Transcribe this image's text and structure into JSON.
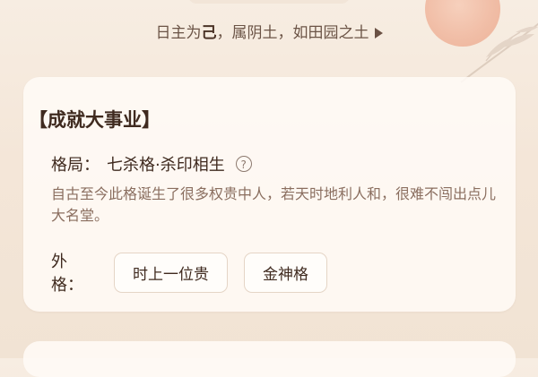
{
  "header": {
    "subtitle_prefix": "日主为",
    "subtitle_element": "己",
    "subtitle_suffix": "，属阴土，如田园之土"
  },
  "card": {
    "title": "【成就大事业】",
    "pattern_label": "格局：",
    "pattern_value": "七杀格·杀印相生",
    "help_icon": "?",
    "description": "自古至今此格诞生了很多权贵中人，若天时地利人和，很难不闯出点儿大名堂。",
    "outer_label": "外格：",
    "outer_tags": [
      "时上一位贵",
      "金神格"
    ]
  },
  "colors": {
    "background": "#f4e6d8",
    "card": "#fffaf5",
    "text_primary": "#3f2a1f",
    "text_muted": "#8a6e5f",
    "chip_border": "#e5d5c6",
    "sun": "#f0b69d"
  },
  "icons": {
    "help": "help-icon",
    "arrow": "chevron-right-icon",
    "decoration": "bamboo-icon"
  }
}
